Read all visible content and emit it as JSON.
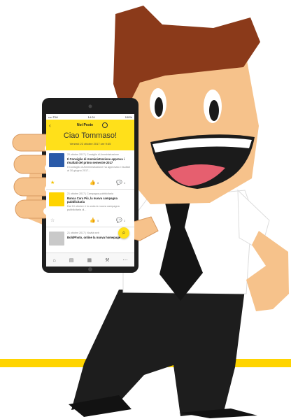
{
  "phone": {
    "status": {
      "carrier": "•••• TIM",
      "time": "14:24",
      "battery": "100%"
    },
    "header": {
      "back_icon": "chevron-left-icon",
      "brand": "Noi Poste",
      "greeting": "Ciao Tommaso!",
      "date": "Venerdì 22 ottobre 2017 ore 9:45"
    },
    "feed": [
      {
        "meta": "20 ottobre 2017 | Consiglio di Amministrazione",
        "title": "Il Consiglio di Amministrazione approva i risultati del primo semestre 2017",
        "excerpt": "Il Consiglio di Amministrazione ha approvato i risultati al 30 giugno 2017...",
        "likes": "8",
        "comments": "4"
      },
      {
        "meta": "21 ottobre 2017 | Campagna pubblicitaria",
        "title": "Banca Cara Più, la nuova campagna pubblicitaria",
        "excerpt": "Dal 10 ottobre è in onda la nuova campagna pubblicitaria di...",
        "likes": "5",
        "comments": "2"
      },
      {
        "meta": "21 ottobre 2017 | Novità web",
        "title": "BoldPhoto, online la nuova homepage",
        "excerpt": "",
        "likes": "",
        "comments": ""
      }
    ],
    "tabs": [
      "home-icon",
      "news-icon",
      "calendar-icon",
      "tools-icon",
      "more-icon"
    ]
  },
  "colors": {
    "accent_yellow": "#ffe01a",
    "hair_brown": "#8b3a1a",
    "skin": "#f6c28b",
    "tie": "#1a1a1a",
    "pants": "#1a1a1a",
    "shirt": "#ffffff"
  }
}
